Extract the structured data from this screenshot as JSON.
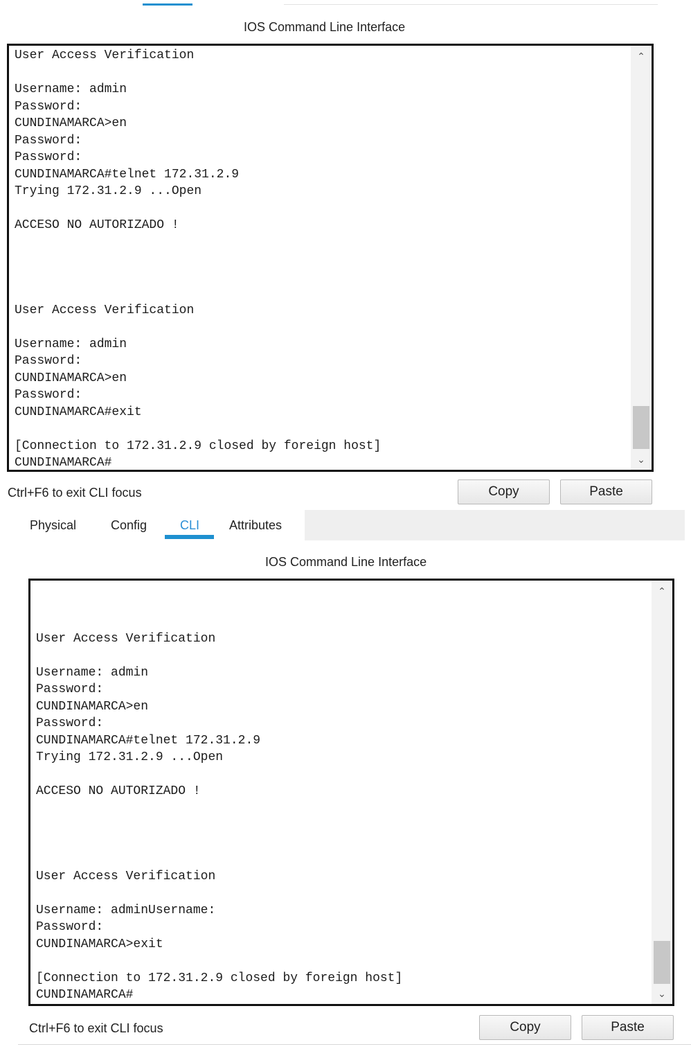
{
  "panel1": {
    "title": "IOS Command Line Interface",
    "terminal_lines": [
      "User Access Verification",
      "",
      "Username: admin",
      "Password:",
      "CUNDINAMARCA>en",
      "Password:",
      "Password:",
      "CUNDINAMARCA#telnet 172.31.2.9",
      "Trying 172.31.2.9 ...Open",
      "",
      "ACCESO NO AUTORIZADO !",
      "",
      "",
      "",
      "",
      "User Access Verification",
      "",
      "Username: admin",
      "Password:",
      "CUNDINAMARCA>en",
      "Password:",
      "CUNDINAMARCA#exit",
      "",
      "[Connection to 172.31.2.9 closed by foreign host]",
      "CUNDINAMARCA#"
    ],
    "hint": "Ctrl+F6 to exit CLI focus",
    "copy_label": "Copy",
    "paste_label": "Paste"
  },
  "tabs": {
    "physical": "Physical",
    "config": "Config",
    "cli": "CLI",
    "attributes": "Attributes",
    "active": "CLI"
  },
  "panel2": {
    "title": "IOS Command Line Interface",
    "terminal_lines": [
      "",
      "",
      "",
      "User Access Verification",
      "",
      "Username: admin",
      "Password:",
      "CUNDINAMARCA>en",
      "Password:",
      "CUNDINAMARCA#telnet 172.31.2.9",
      "Trying 172.31.2.9 ...Open",
      "",
      "ACCESO NO AUTORIZADO !",
      "",
      "",
      "",
      "",
      "User Access Verification",
      "",
      "Username: adminUsername:",
      "Password:",
      "CUNDINAMARCA>exit",
      "",
      "[Connection to 172.31.2.9 closed by foreign host]",
      "CUNDINAMARCA#"
    ],
    "hint": "Ctrl+F6 to exit CLI focus",
    "copy_label": "Copy",
    "paste_label": "Paste"
  },
  "colors": {
    "tab_accent": "#1e90d0",
    "active_tab_text": "#2c8fd6",
    "terminal_border": "#111111"
  },
  "icons": {
    "scroll_up": "chevron-up-icon",
    "scroll_down": "chevron-down-icon"
  }
}
